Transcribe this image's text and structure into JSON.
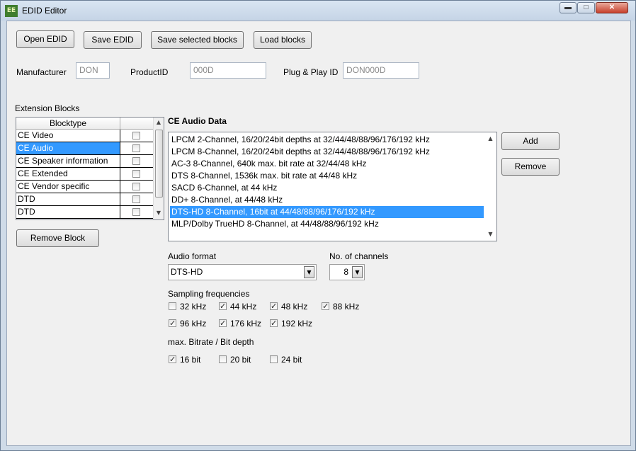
{
  "window": {
    "title": "EDID Editor",
    "icon_text": "EE",
    "minimize": "▬",
    "maximize": "□",
    "close": "✕"
  },
  "toolbar": {
    "open": "Open EDID",
    "save": "Save EDID",
    "save_selected": "Save selected blocks",
    "load_blocks": "Load blocks"
  },
  "header_fields": {
    "manufacturer_label": "Manufacturer",
    "manufacturer_value": "DON",
    "productid_label": "ProductID",
    "productid_value": "000D",
    "pnp_label": "Plug & Play ID",
    "pnp_value": "DON000D"
  },
  "extension_blocks": {
    "label": "Extension Blocks",
    "column": "Blocktype",
    "rows": [
      {
        "name": "CE Video",
        "checked": false,
        "selected": false
      },
      {
        "name": "CE Audio",
        "checked": false,
        "selected": true
      },
      {
        "name": "CE Speaker information",
        "checked": false,
        "selected": false
      },
      {
        "name": "CE Extended",
        "checked": false,
        "selected": false
      },
      {
        "name": "CE Vendor specific",
        "checked": false,
        "selected": false
      },
      {
        "name": "DTD",
        "checked": false,
        "selected": false
      },
      {
        "name": "DTD",
        "checked": false,
        "selected": false
      }
    ],
    "remove_button": "Remove Block"
  },
  "audio_data": {
    "title": "CE Audio Data",
    "items": [
      "LPCM 2-Channel, 16/20/24bit depths at 32/44/48/88/96/176/192 kHz",
      "LPCM 8-Channel, 16/20/24bit depths at 32/44/48/88/96/176/192 kHz",
      "AC-3 8-Channel, 640k max. bit rate at 32/44/48 kHz",
      "DTS 8-Channel, 1536k max. bit rate at 44/48 kHz",
      "SACD 6-Channel,  at 44 kHz",
      "DD+ 8-Channel,  at 44/48 kHz",
      "DTS-HD 8-Channel, 16bit at 44/48/88/96/176/192 kHz",
      "MLP/Dolby TrueHD 8-Channel,  at 44/48/88/96/192 kHz"
    ],
    "selected_index": 6,
    "add_button": "Add",
    "remove_button": "Remove"
  },
  "format": {
    "audio_format_label": "Audio format",
    "audio_format_value": "DTS-HD",
    "channels_label": "No. of channels",
    "channels_value": "8"
  },
  "sampling": {
    "label": "Sampling frequencies",
    "options": [
      {
        "label": "32 kHz",
        "checked": false
      },
      {
        "label": "44 kHz",
        "checked": true
      },
      {
        "label": "48 kHz",
        "checked": true
      },
      {
        "label": "88 kHz",
        "checked": true
      },
      {
        "label": "96 kHz",
        "checked": true
      },
      {
        "label": "176 kHz",
        "checked": true
      },
      {
        "label": "192 kHz",
        "checked": true
      }
    ]
  },
  "bitdepth": {
    "label": "max. Bitrate / Bit depth",
    "options": [
      {
        "label": "16 bit",
        "checked": true
      },
      {
        "label": "20 bit",
        "checked": false
      },
      {
        "label": "24 bit",
        "checked": false
      }
    ]
  }
}
